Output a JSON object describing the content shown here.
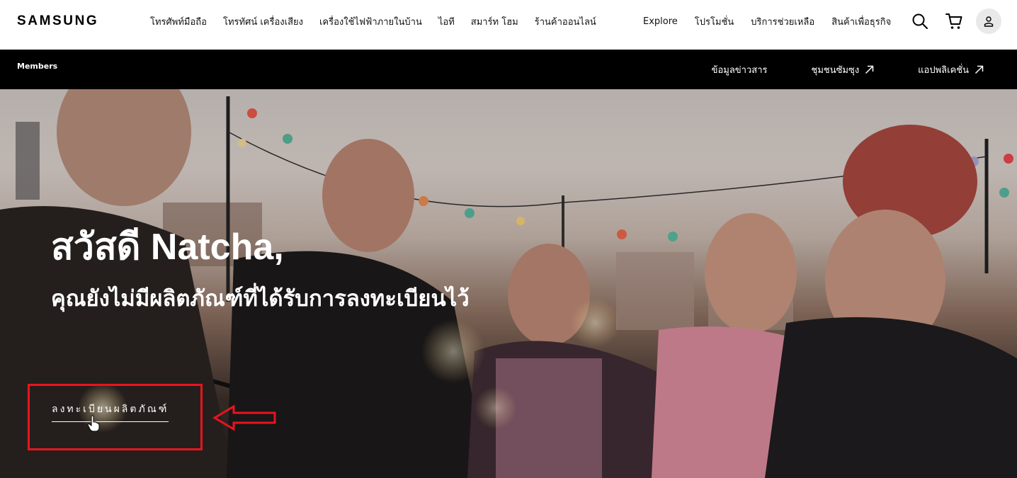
{
  "brand": {
    "logo_text": "SAMSUNG"
  },
  "nav": {
    "left_items": [
      {
        "label": "โทรศัพท์มือถือ"
      },
      {
        "label": "โทรทัศน์ เครื่องเสียง"
      },
      {
        "label": "เครื่องใช้ไฟฟ้าภายในบ้าน"
      },
      {
        "label": "ไอที"
      },
      {
        "label": "สมาร์ท โฮม"
      },
      {
        "label": "ร้านค้าออนไลน์"
      }
    ],
    "right_items": [
      {
        "label": "Explore"
      },
      {
        "label": "โปรโมชั่น"
      },
      {
        "label": "บริการช่วยเหลือ"
      },
      {
        "label": "สินค้าเพื่อธุรกิจ"
      }
    ],
    "icons": [
      "search-icon",
      "cart-icon",
      "user-icon"
    ]
  },
  "members_bar": {
    "title": "Members",
    "links": [
      {
        "label": "ข้อมูลข่าวสาร",
        "external": false
      },
      {
        "label": "ชุมชนซัมซุง",
        "external": true
      },
      {
        "label": "แอปพลิเคชั่น",
        "external": true
      }
    ]
  },
  "hero": {
    "greeting": "สวัสดี Natcha,",
    "message": "คุณยังไม่มีผลิตภัณฑ์ที่ได้รับการลงทะเบียนไว้",
    "cta_label": "ลงทะเบียนผลิตภัณฑ์"
  },
  "annotation": {
    "color": "#e8141e"
  }
}
